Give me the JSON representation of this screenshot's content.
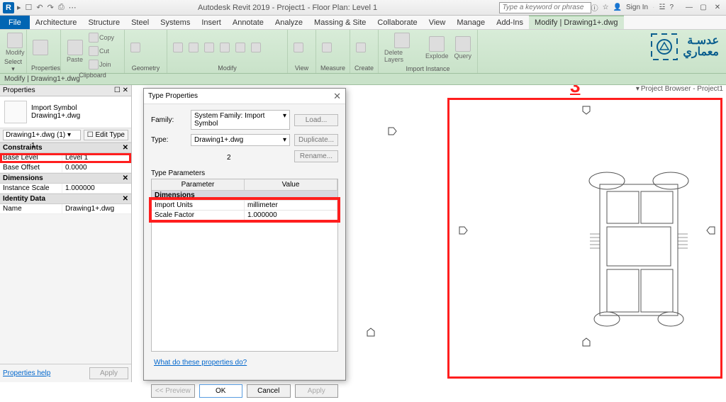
{
  "titlebar": {
    "app_letter": "R",
    "title": "Autodesk Revit 2019 - Project1 - Floor Plan: Level 1",
    "search_placeholder": "Type a keyword or phrase",
    "signin": "Sign In"
  },
  "menu": {
    "file": "File",
    "tabs": [
      "Architecture",
      "Structure",
      "Steel",
      "Systems",
      "Insert",
      "Annotate",
      "Analyze",
      "Massing & Site",
      "Collaborate",
      "View",
      "Manage",
      "Add-Ins"
    ],
    "active": "Modify | Drawing1+.dwg"
  },
  "ribbon": {
    "groups": {
      "select": {
        "label": "Select ▾",
        "items": [
          "Modify",
          "Properties"
        ]
      },
      "properties": "Properties",
      "clipboard": {
        "label": "Clipboard",
        "paste": "Paste",
        "copy": "Copy",
        "cut": "Cut",
        "join": "Join"
      },
      "geometry": "Geometry",
      "modify": "Modify",
      "view": "View",
      "measure": "Measure",
      "create": "Create",
      "import": {
        "label": "Import Instance",
        "delete": "Delete Layers",
        "explode": "Explode",
        "query": "Query"
      }
    },
    "logo_text": "عدسـة\nمعماري"
  },
  "context_bar": "Modify | Drawing1+.dwg",
  "properties": {
    "title": "Properties",
    "type_name": "Import Symbol",
    "type_sub": "Drawing1+.dwg",
    "selector": "Drawing1+.dwg (1)",
    "edit_type": "Edit Type",
    "groups": {
      "constraints": "Constraints",
      "dimensions": "Dimensions",
      "identity": "Identity Data"
    },
    "rows": {
      "base_level": {
        "k": "Base Level",
        "v": "Level 1"
      },
      "base_offset": {
        "k": "Base Offset",
        "v": "0.0000"
      },
      "instance_scale": {
        "k": "Instance Scale",
        "v": "1.000000"
      },
      "name": {
        "k": "Name",
        "v": "Drawing1+.dwg"
      }
    },
    "help": "Properties help",
    "apply": "Apply"
  },
  "dialog": {
    "title": "Type Properties",
    "family_lbl": "Family:",
    "family_val": "System Family: Import Symbol",
    "type_lbl": "Type:",
    "type_val": "Drawing1+.dwg",
    "load": "Load...",
    "duplicate": "Duplicate...",
    "rename": "Rename...",
    "tp_label": "Type Parameters",
    "col_param": "Parameter",
    "col_value": "Value",
    "grp_dimensions": "Dimensions",
    "rows": {
      "import_units": {
        "k": "Import Units",
        "v": "millimeter"
      },
      "scale_factor": {
        "k": "Scale Factor",
        "v": "1.000000"
      }
    },
    "link": "What do these properties do?",
    "preview": "<< Preview",
    "ok": "OK",
    "cancel": "Cancel",
    "apply": "Apply"
  },
  "project_browser": "Project Browser - Project1",
  "annotations": {
    "n1": "1",
    "n2": "2",
    "n3": "3"
  }
}
